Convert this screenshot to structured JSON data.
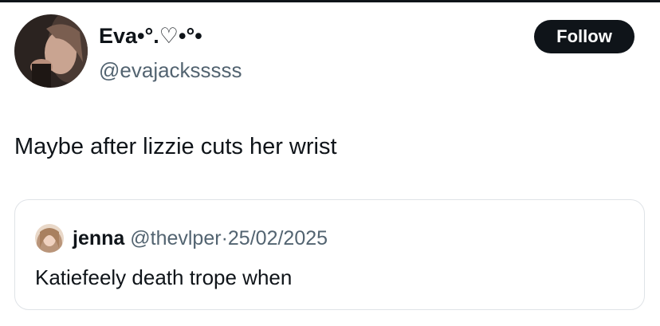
{
  "tweet": {
    "author": {
      "display_name": "Eva•°.♡•°•",
      "handle": "@evajacksssss"
    },
    "follow_label": "Follow",
    "text": "Maybe after lizzie cuts her wrist"
  },
  "quoted_tweet": {
    "author": {
      "name": "jenna",
      "handle": "@thevlper",
      "separator": "·",
      "date": "25/02/2025"
    },
    "text": "Katiefeely death trope when"
  },
  "colors": {
    "text_primary": "#0f1419",
    "text_secondary": "#536471",
    "follow_button_bg": "#0f1419",
    "card_border": "#dfe3e7"
  }
}
